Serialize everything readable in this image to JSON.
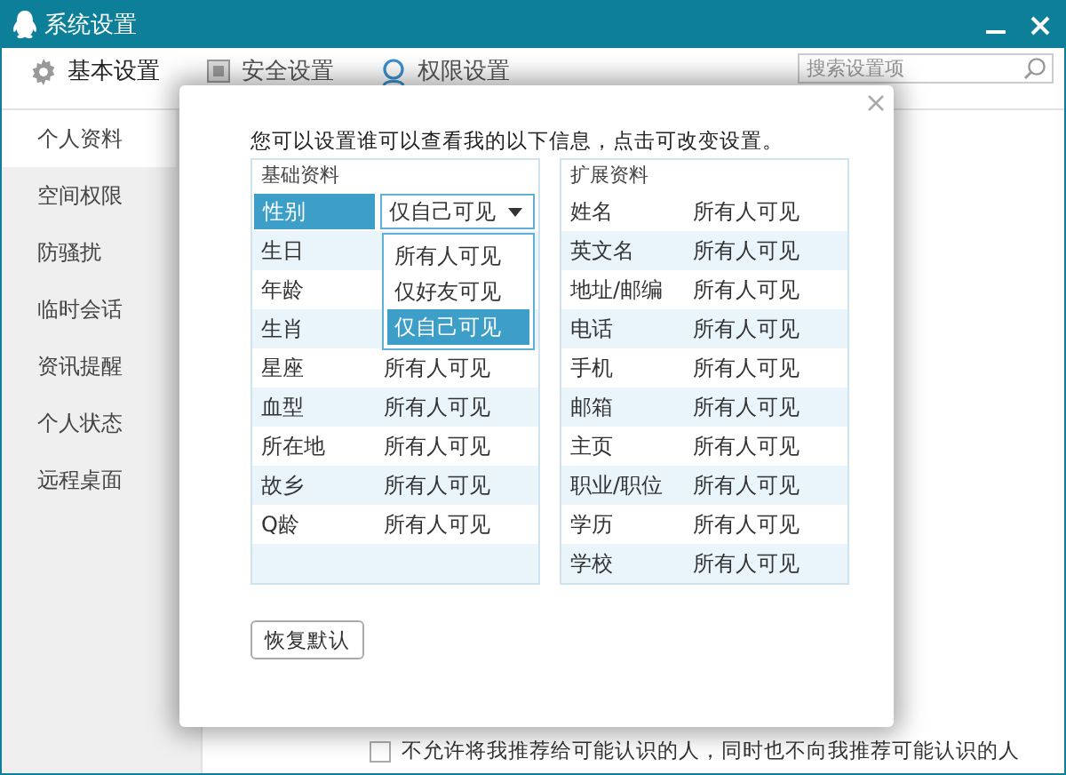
{
  "window": {
    "title": "系统设置"
  },
  "tabs": [
    {
      "label": "基本设置",
      "selected": true
    },
    {
      "label": "安全设置",
      "selected": false
    },
    {
      "label": "权限设置",
      "selected": false
    }
  ],
  "search": {
    "placeholder": "搜索设置项"
  },
  "sidebar": {
    "items": [
      {
        "label": "个人资料",
        "selected": true
      },
      {
        "label": "空间权限",
        "selected": false
      },
      {
        "label": "防骚扰",
        "selected": false
      },
      {
        "label": "临时会话",
        "selected": false
      },
      {
        "label": "资讯提醒",
        "selected": false
      },
      {
        "label": "个人状态",
        "selected": false
      },
      {
        "label": "远程桌面",
        "selected": false
      }
    ]
  },
  "recommend_option": {
    "label": "不允许将我推荐给可能认识的人，同时也不向我推荐可能认识的人",
    "checked": false
  },
  "dialog": {
    "intro": "您可以设置谁可以查看我的以下信息，点击可改变设置。",
    "basic": {
      "title": "基础资料",
      "rows": [
        {
          "kind": "select",
          "label": "性别",
          "value": "仅自己可见",
          "options": [
            {
              "label": "所有人可见",
              "selected": false
            },
            {
              "label": "仅好友可见",
              "selected": false
            },
            {
              "label": "仅自己可见",
              "selected": true
            }
          ]
        },
        {
          "kind": "text",
          "label": "生日"
        },
        {
          "kind": "text",
          "label": "年龄"
        },
        {
          "kind": "text",
          "label": "生肖"
        },
        {
          "kind": "text",
          "label": "星座",
          "value": "所有人可见"
        },
        {
          "kind": "text",
          "label": "血型",
          "value": "所有人可见"
        },
        {
          "kind": "text",
          "label": "所在地",
          "value": "所有人可见"
        },
        {
          "kind": "text",
          "label": "故乡",
          "value": "所有人可见"
        },
        {
          "kind": "text",
          "label": "Q龄",
          "value": "所有人可见"
        }
      ]
    },
    "extended": {
      "title": "扩展资料",
      "rows": [
        {
          "kind": "text",
          "label": "姓名",
          "value": "所有人可见"
        },
        {
          "kind": "text",
          "label": "英文名",
          "value": "所有人可见"
        },
        {
          "kind": "text",
          "label": "地址/邮编",
          "value": "所有人可见"
        },
        {
          "kind": "text",
          "label": "电话",
          "value": "所有人可见"
        },
        {
          "kind": "text",
          "label": "手机",
          "value": "所有人可见"
        },
        {
          "kind": "text",
          "label": "邮箱",
          "value": "所有人可见"
        },
        {
          "kind": "text",
          "label": "主页",
          "value": "所有人可见"
        },
        {
          "kind": "text",
          "label": "职业/职位",
          "value": "所有人可见"
        },
        {
          "kind": "text",
          "label": "学历",
          "value": "所有人可见"
        },
        {
          "kind": "text",
          "label": "学校",
          "value": "所有人可见"
        }
      ]
    },
    "reset_button": "恢复默认"
  }
}
